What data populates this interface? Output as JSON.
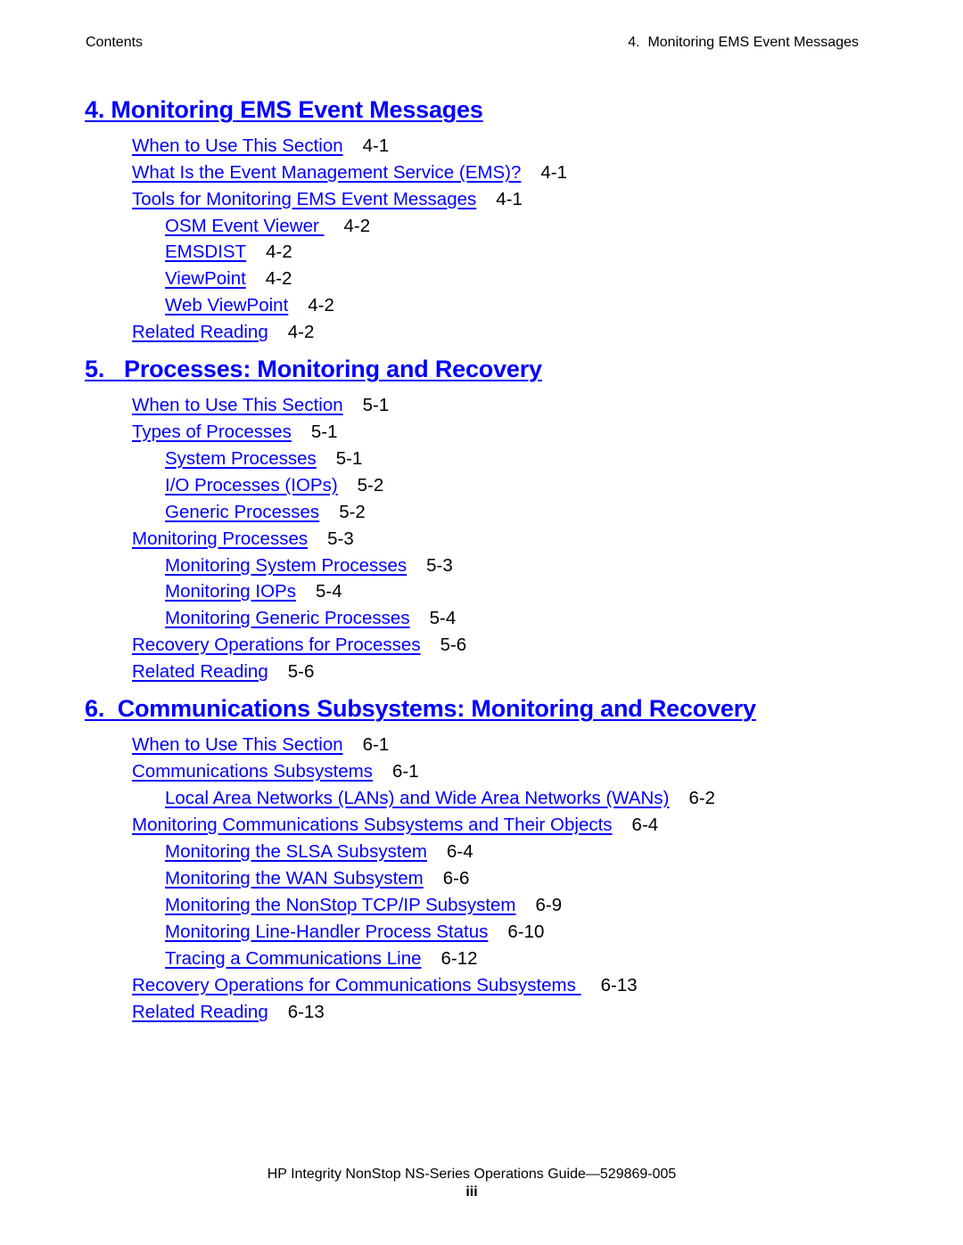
{
  "header": {
    "left": "Contents",
    "right": "4.  Monitoring EMS Event Messages"
  },
  "chapters": [
    {
      "title": "4.  Monitoring EMS Event Messages",
      "entries": [
        {
          "label": "When to Use This Section",
          "page": "4-1",
          "level": 1
        },
        {
          "label": "What Is the Event Management Service (EMS)?",
          "page": "4-1",
          "level": 1
        },
        {
          "label": "Tools for Monitoring EMS Event Messages",
          "page": "4-1",
          "level": 1
        },
        {
          "label": "OSM Event Viewer ",
          "page": "4-2",
          "level": 2
        },
        {
          "label": "EMSDIST",
          "page": "4-2",
          "level": 2
        },
        {
          "label": "ViewPoint",
          "page": "4-2",
          "level": 2
        },
        {
          "label": "Web ViewPoint",
          "page": "4-2",
          "level": 2
        },
        {
          "label": "Related Reading",
          "page": "4-2",
          "level": 1
        }
      ]
    },
    {
      "title": "5.   Processes: Monitoring and Recovery",
      "entries": [
        {
          "label": "When to Use This Section",
          "page": "5-1",
          "level": 1
        },
        {
          "label": "Types of Processes",
          "page": "5-1",
          "level": 1
        },
        {
          "label": "System Processes",
          "page": "5-1",
          "level": 2
        },
        {
          "label": "I/O Processes (IOPs)",
          "page": "5-2",
          "level": 2
        },
        {
          "label": "Generic Processes",
          "page": "5-2",
          "level": 2
        },
        {
          "label": "Monitoring Processes",
          "page": "5-3",
          "level": 1
        },
        {
          "label": "Monitoring System Processes",
          "page": "5-3",
          "level": 2
        },
        {
          "label": "Monitoring IOPs",
          "page": "5-4",
          "level": 2
        },
        {
          "label": "Monitoring Generic Processes",
          "page": "5-4",
          "level": 2
        },
        {
          "label": "Recovery Operations for Processes",
          "page": "5-6",
          "level": 1
        },
        {
          "label": "Related Reading",
          "page": "5-6",
          "level": 1
        }
      ]
    },
    {
      "title": "6.  Communications Subsystems: Monitoring and Recovery",
      "entries": [
        {
          "label": "When to Use This Section",
          "page": "6-1",
          "level": 1
        },
        {
          "label": "Communications Subsystems",
          "page": "6-1",
          "level": 1
        },
        {
          "label": "Local Area Networks (LANs) and Wide Area Networks (WANs)",
          "page": "6-2",
          "level": 2
        },
        {
          "label": "Monitoring Communications Subsystems and Their Objects",
          "page": "6-4",
          "level": 1
        },
        {
          "label": "Monitoring the SLSA Subsystem",
          "page": "6-4",
          "level": 2
        },
        {
          "label": "Monitoring the WAN Subsystem",
          "page": "6-6",
          "level": 2
        },
        {
          "label": "Monitoring the NonStop TCP/IP Subsystem",
          "page": "6-9",
          "level": 2
        },
        {
          "label": "Monitoring Line-Handler Process Status",
          "page": "6-10",
          "level": 2
        },
        {
          "label": "Tracing a Communications Line",
          "page": "6-12",
          "level": 2
        },
        {
          "label": "Recovery Operations for Communications Subsystems ",
          "page": "6-13",
          "level": 1
        },
        {
          "label": "Related Reading",
          "page": "6-13",
          "level": 1
        }
      ]
    }
  ],
  "footer": {
    "title": "HP Integrity NonStop NS-Series Operations Guide—529869-005",
    "page_number": "iii"
  }
}
